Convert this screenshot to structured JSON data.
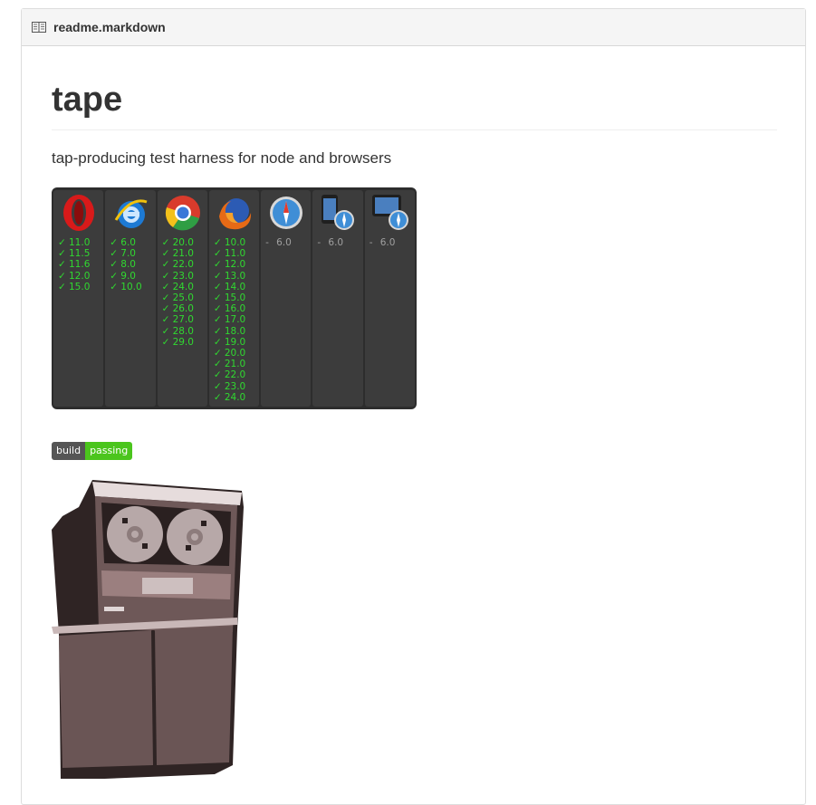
{
  "header": {
    "filename": "readme.markdown",
    "icon": "book-icon"
  },
  "readme": {
    "title": "tape",
    "description": "tap-producing test harness for node and browsers"
  },
  "browser_matrix": {
    "columns": [
      {
        "browser": "opera",
        "icon": "opera-icon",
        "status": "pass",
        "versions": [
          "11.0",
          "11.5",
          "11.6",
          "12.0",
          "15.0"
        ]
      },
      {
        "browser": "ie",
        "icon": "internet-explorer-icon",
        "status": "pass",
        "versions": [
          "6.0",
          "7.0",
          "8.0",
          "9.0",
          "10.0"
        ]
      },
      {
        "browser": "chrome",
        "icon": "chrome-icon",
        "status": "pass",
        "versions": [
          "20.0",
          "21.0",
          "22.0",
          "23.0",
          "24.0",
          "25.0",
          "26.0",
          "27.0",
          "28.0",
          "29.0"
        ]
      },
      {
        "browser": "firefox",
        "icon": "firefox-icon",
        "status": "pass",
        "versions": [
          "10.0",
          "11.0",
          "12.0",
          "13.0",
          "14.0",
          "15.0",
          "16.0",
          "17.0",
          "18.0",
          "19.0",
          "20.0",
          "21.0",
          "22.0",
          "23.0",
          "24.0"
        ]
      },
      {
        "browser": "safari",
        "icon": "safari-icon",
        "status": "na",
        "versions": [
          "6.0"
        ]
      },
      {
        "browser": "iphone",
        "icon": "iphone-safari-icon",
        "status": "na",
        "versions": [
          "6.0"
        ]
      },
      {
        "browser": "ipad",
        "icon": "ipad-safari-icon",
        "status": "na",
        "versions": [
          "6.0"
        ]
      }
    ],
    "pass_mark": "✓",
    "na_mark": "-",
    "pass_color": "#30d930",
    "na_color": "#a0a0a0"
  },
  "build_badge": {
    "label": "build",
    "status": "passing",
    "status_color": "#4bc51d"
  },
  "illustration": {
    "icon": "tape-machine-image"
  }
}
